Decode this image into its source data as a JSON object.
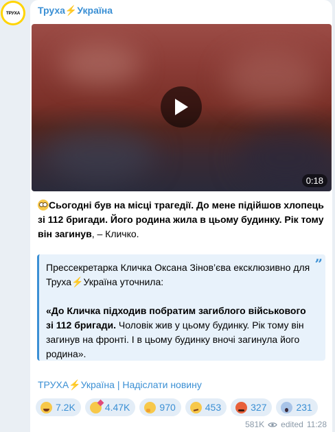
{
  "channel": {
    "avatar_text": "ТРУХА",
    "name": "Труха⚡️Україна"
  },
  "video": {
    "duration": "0:18"
  },
  "post": {
    "emoji": "flushed-face-icon",
    "paragraph_bold": "Сьогодні був на місці трагедії. До мене підійшов хлопець зі 112 бригади. Його родина жила в цьому будинку. Рік тому він загинув",
    "paragraph_rest": ", – Кличко."
  },
  "quote": {
    "line1": "Прессекретарка Кличка Оксана Зінов’єва ексклюзивно для Труха⚡️Україна уточнила:",
    "bold": "«До Кличка підходив побратим загиблого військового зі 112 бригади.",
    "rest": " Чоловік жив у цьому будинку. Рік тому він загинув на фронті. І в цьому будинку вночі загинула його родина»."
  },
  "footer": {
    "link_text": "ТРУХА⚡️Україна | Надіслати новину"
  },
  "reactions": [
    {
      "emoji": "grinning-face-icon",
      "count": "7.2K"
    },
    {
      "emoji": "exploding-head-icon",
      "count": "4.47K"
    },
    {
      "emoji": "thinking-face-icon",
      "count": "970"
    },
    {
      "emoji": "smirking-face-icon",
      "count": "453"
    },
    {
      "emoji": "angry-face-icon",
      "count": "327"
    },
    {
      "emoji": "screaming-face-icon",
      "count": "231"
    }
  ],
  "meta": {
    "views": "581K",
    "edited": "edited",
    "time": "11:28"
  },
  "colors": {
    "accent": "#3a8fd4",
    "quote_bg": "#e8f2fb",
    "reaction_bg": "#e3edf7",
    "page_bg": "#eaeff4"
  }
}
